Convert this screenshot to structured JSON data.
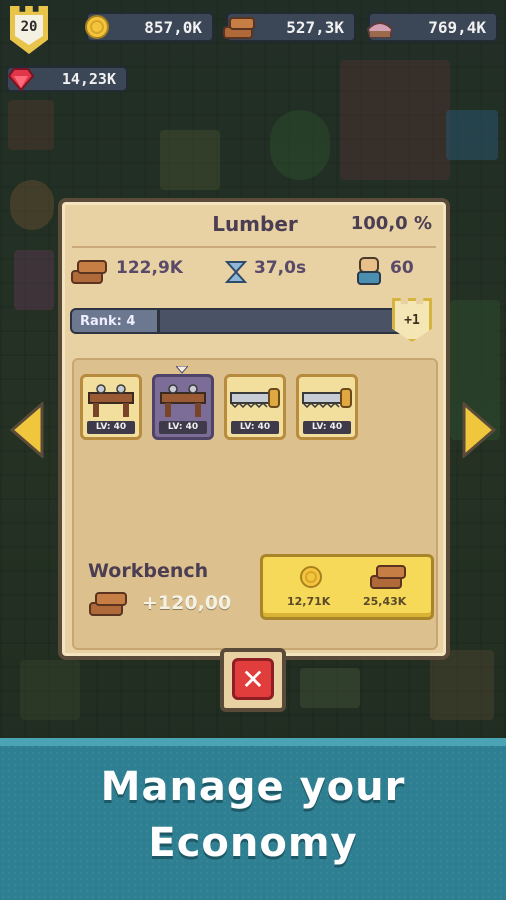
{
  "player": {
    "level": "20"
  },
  "resources": {
    "coins": "857,0K",
    "wood": "527,3K",
    "food": "769,4K",
    "gems": "14,23K"
  },
  "panel": {
    "title": "Lumber",
    "progress": "100,0 %",
    "wood_amount": "122,9K",
    "time": "37,0s",
    "workers": "60",
    "rank_label": "Rank: 4",
    "rank_badge": "+1",
    "tools": [
      {
        "name": "workbench-tool",
        "level": "LV: 40",
        "selected": false
      },
      {
        "name": "workbench-tool",
        "level": "LV: 40",
        "selected": true
      },
      {
        "name": "saw-tool",
        "level": "LV: 40",
        "selected": false
      },
      {
        "name": "saw-tool",
        "level": "LV: 40",
        "selected": false
      }
    ],
    "item_name": "Workbench",
    "item_bonus": "+120,00",
    "cost_coins": "12,71K",
    "cost_wood": "25,43K"
  },
  "banner": {
    "line1": "Manage your",
    "line2": "Economy"
  },
  "colors": {
    "accent_yellow": "#f6d958",
    "close_red": "#e23d3d",
    "banner_teal": "#2f7f92"
  }
}
